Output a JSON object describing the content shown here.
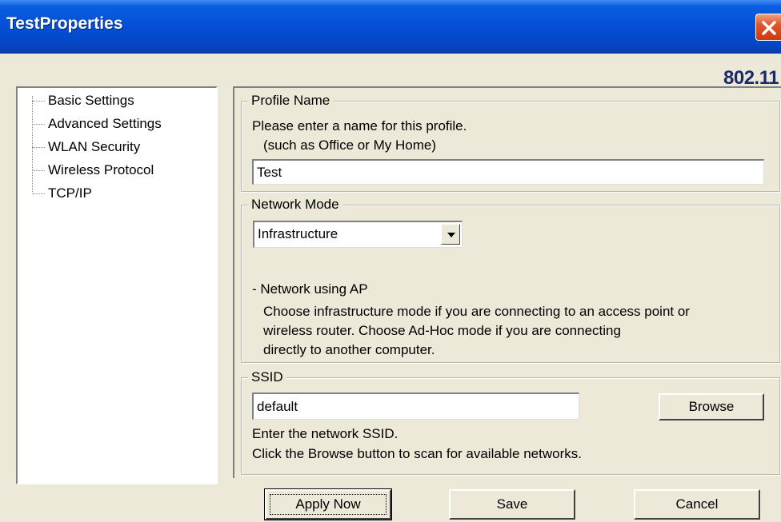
{
  "window": {
    "title": "TestProperties",
    "brand": "802.11"
  },
  "tree": {
    "items": [
      {
        "label": "Basic Settings"
      },
      {
        "label": "Advanced Settings"
      },
      {
        "label": "WLAN Security"
      },
      {
        "label": "Wireless Protocol"
      },
      {
        "label": "TCP/IP"
      }
    ]
  },
  "profile": {
    "legend": "Profile Name",
    "instruction": "Please enter a name for this profile.",
    "example": "(such as Office or My Home)",
    "value": "Test"
  },
  "network_mode": {
    "legend": "Network Mode",
    "selected": "Infrastructure",
    "desc_title": "- Network using AP",
    "desc_line1": "Choose infrastructure mode if you are connecting to an access point or",
    "desc_line2": "wireless router. Choose Ad-Hoc mode if you are connecting",
    "desc_line3": "directly to another computer."
  },
  "ssid": {
    "legend": "SSID",
    "value": "default",
    "browse_label": "Browse",
    "help1": "Enter the network SSID.",
    "help2": "Click the Browse button to scan for available networks."
  },
  "buttons": {
    "apply": "Apply Now",
    "save": "Save",
    "cancel": "Cancel"
  },
  "colors": {
    "titlebar": "#0550d6",
    "close": "#e2552a",
    "dialog_bg": "#ece9d8",
    "brand": "#1a2a6c"
  }
}
